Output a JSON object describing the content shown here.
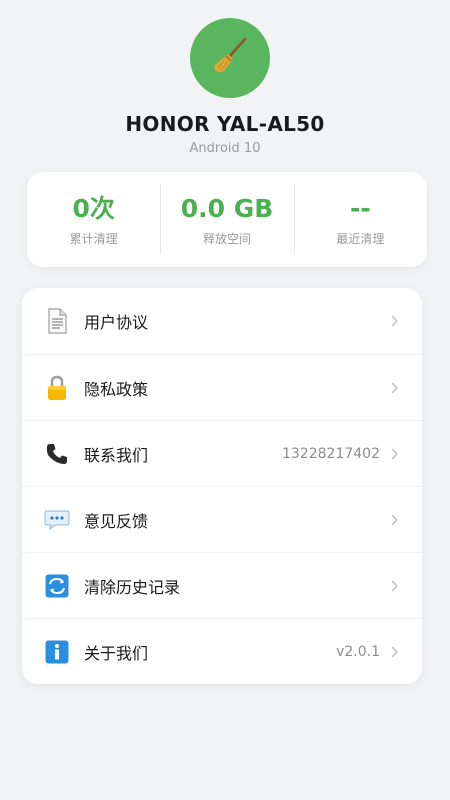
{
  "device": {
    "name": "HONOR YAL-AL50",
    "os": "Android 10",
    "avatar_icon": "broom-icon",
    "avatar_color": "#5ab65e"
  },
  "stats": [
    {
      "value": "0次",
      "label": "累计清理"
    },
    {
      "value": "0.0 GB",
      "label": "释放空间"
    },
    {
      "value": "--",
      "label": "最近清理"
    }
  ],
  "menu": {
    "items": [
      {
        "label": "用户协议",
        "icon": "document-icon",
        "value": ""
      },
      {
        "label": "隐私政策",
        "icon": "lock-icon",
        "value": ""
      },
      {
        "label": "联系我们",
        "icon": "phone-icon",
        "value": "13228217402"
      },
      {
        "label": "意见反馈",
        "icon": "chat-bubble-icon",
        "value": ""
      },
      {
        "label": "清除历史记录",
        "icon": "refresh-icon",
        "value": ""
      },
      {
        "label": "关于我们",
        "icon": "info-icon",
        "value": "v2.0.1"
      }
    ]
  },
  "colors": {
    "accent": "#4caf50",
    "background": "#f2f3f5"
  }
}
